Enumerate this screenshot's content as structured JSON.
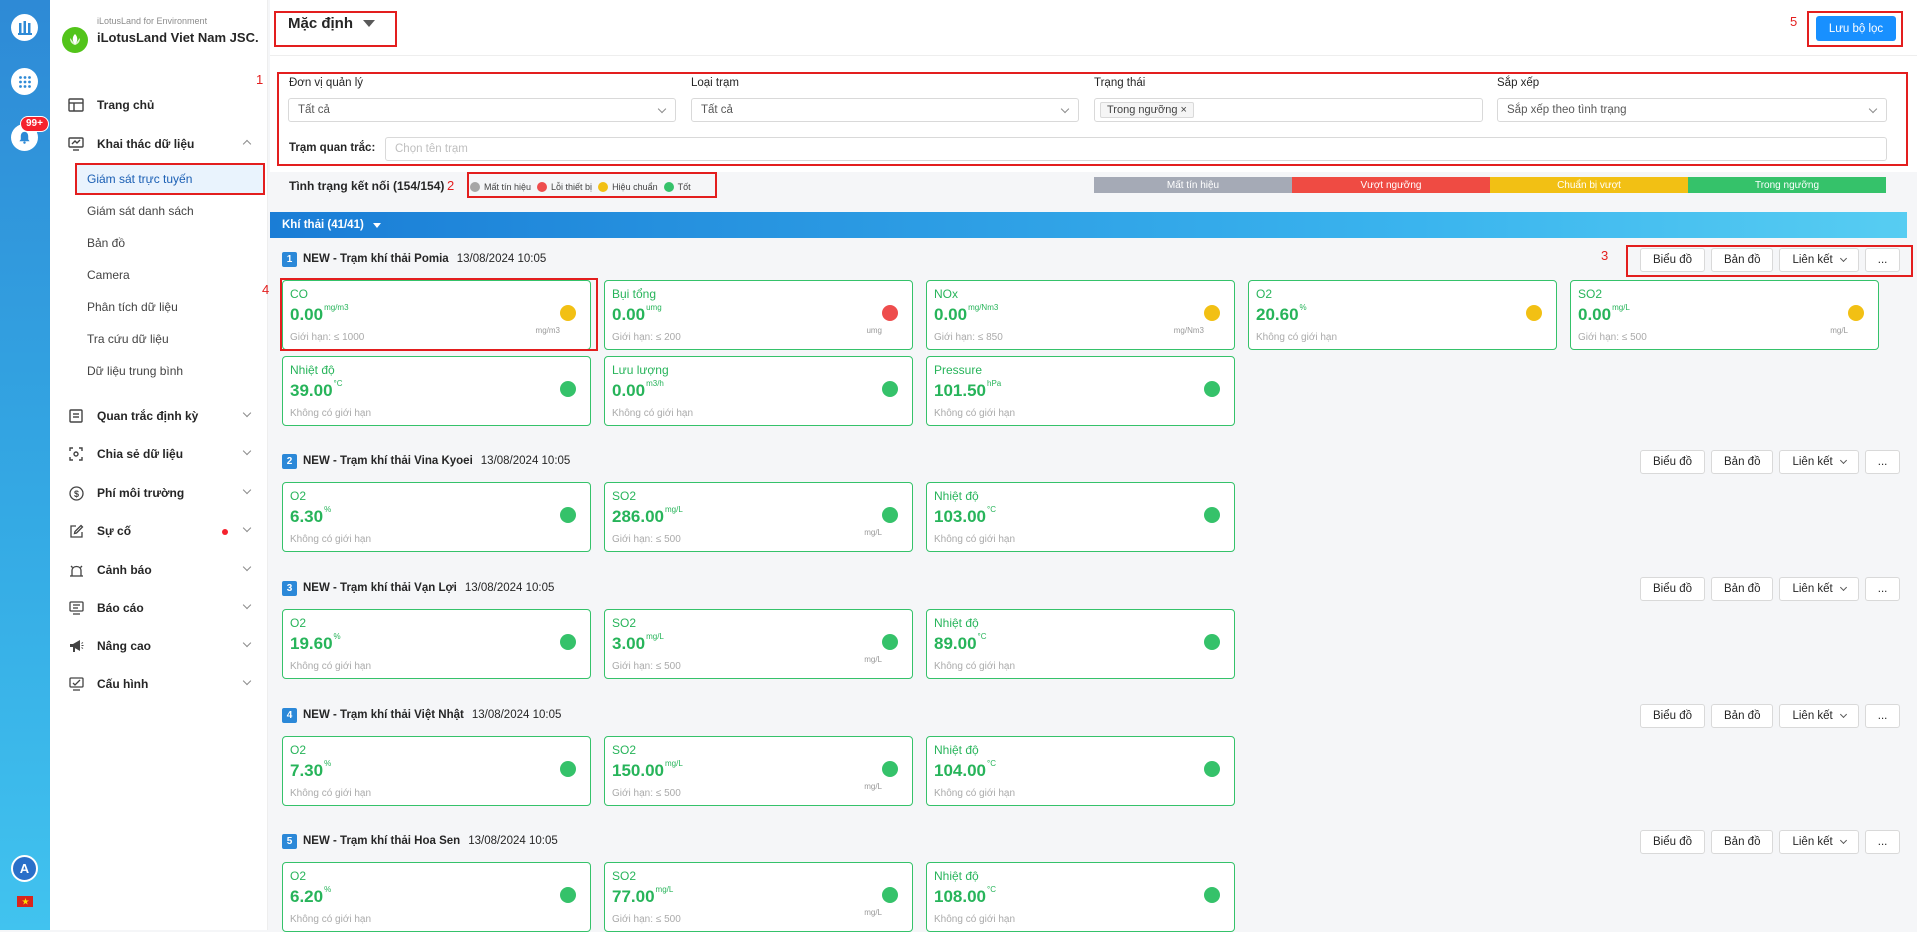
{
  "rail": {
    "badge": "99+",
    "avatar": "A"
  },
  "brand": {
    "sub": "iLotusLand for Environment",
    "name": "iLotusLand Viet Nam JSC."
  },
  "menu": {
    "home": "Trang chủ",
    "data_mining": "Khai thác dữ liệu",
    "sub": [
      "Giám sát trực tuyến",
      "Giám sát danh sách",
      "Bản đồ",
      "Camera",
      "Phân tích dữ liệu",
      "Tra cứu dữ liệu",
      "Dữ liệu trung bình"
    ],
    "periodic": "Quan trắc định kỳ",
    "share": "Chia sẻ dữ liệu",
    "fee": "Phí môi trường",
    "incident": "Sự cố",
    "alert": "Cảnh báo",
    "report": "Báo cáo",
    "advanced": "Nâng cao",
    "config": "Cấu hình"
  },
  "header": {
    "preset": "Mặc định",
    "save": "Lưu bộ lọc"
  },
  "annotations": [
    "1",
    "2",
    "3",
    "4",
    "5"
  ],
  "filters": {
    "unit_label": "Đơn vị quản lý",
    "unit_value": "Tất cả",
    "type_label": "Loại trạm",
    "type_value": "Tất cả",
    "status_label": "Trạng thái",
    "status_tag": "Trong ngưỡng",
    "sort_label": "Sắp xếp",
    "sort_value": "Sắp xếp theo tình trạng",
    "station_label": "Trạm quan trắc:",
    "station_placeholder": "Chọn tên trạm"
  },
  "connection": {
    "label": "Tình trạng kết nối (154/154)",
    "legend": [
      {
        "label": "Mất tín hiệu",
        "color": "#a6a6a6"
      },
      {
        "label": "Lỗi thiết bị",
        "color": "#ee4d4d"
      },
      {
        "label": "Hiệu chuẩn",
        "color": "#f2c014"
      },
      {
        "label": "Tốt",
        "color": "#35c26a"
      }
    ],
    "bar": [
      {
        "label": "Mất tín hiệu",
        "color": "#a5aab6"
      },
      {
        "label": "Vượt ngưỡng",
        "color": "#ef4b43"
      },
      {
        "label": "Chuẩn bị vượt",
        "color": "#f2c014"
      },
      {
        "label": "Trong ngưỡng",
        "color": "#35c26a"
      }
    ]
  },
  "group": {
    "label": "Khí thải (41/41)"
  },
  "actions": {
    "chart": "Biểu đồ",
    "map": "Bản đồ",
    "link": "Liên kết",
    "more": "..."
  },
  "stations": [
    {
      "num": "1",
      "name": "NEW - Trạm khí thải Pomia",
      "time": "13/08/2024 10:05",
      "cards": [
        {
          "name": "CO",
          "value": "0.00",
          "unit": "mg/m3",
          "limit": "Giới hạn: ≤ 1000",
          "unit2": "mg/m3",
          "dot": "#f2c014"
        },
        {
          "name": "Bụi tổng",
          "value": "0.00",
          "unit": "umg",
          "limit": "Giới hạn: ≤ 200",
          "unit2": "umg",
          "dot": "#ee4d4d"
        },
        {
          "name": "NOx",
          "value": "0.00",
          "unit": "mg/Nm3",
          "limit": "Giới hạn: ≤ 850",
          "unit2": "mg/Nm3",
          "dot": "#f2c014"
        },
        {
          "name": "O2",
          "value": "20.60",
          "unit": "%",
          "limit": "Không có giới hạn",
          "unit2": "",
          "dot": "#f2c014"
        },
        {
          "name": "SO2",
          "value": "0.00",
          "unit": "mg/L",
          "limit": "Giới hạn: ≤ 500",
          "unit2": "mg/L",
          "dot": "#f2c014"
        },
        {
          "name": "Nhiệt độ",
          "value": "39.00",
          "unit": "°C",
          "limit": "Không có giới hạn",
          "unit2": "",
          "dot": "#35c26a"
        },
        {
          "name": "Lưu lượng",
          "value": "0.00",
          "unit": "m3/h",
          "limit": "Không có giới hạn",
          "unit2": "",
          "dot": "#35c26a"
        },
        {
          "name": "Pressure",
          "value": "101.50",
          "unit": "hPa",
          "limit": "Không có giới hạn",
          "unit2": "",
          "dot": "#35c26a"
        }
      ]
    },
    {
      "num": "2",
      "name": "NEW - Trạm khí thải Vina Kyoei",
      "time": "13/08/2024 10:05",
      "cards": [
        {
          "name": "O2",
          "value": "6.30",
          "unit": "%",
          "limit": "Không có giới hạn",
          "unit2": "",
          "dot": "#35c26a"
        },
        {
          "name": "SO2",
          "value": "286.00",
          "unit": "mg/L",
          "limit": "Giới hạn: ≤ 500",
          "unit2": "mg/L",
          "dot": "#35c26a"
        },
        {
          "name": "Nhiệt độ",
          "value": "103.00",
          "unit": "°C",
          "limit": "Không có giới hạn",
          "unit2": "",
          "dot": "#35c26a"
        }
      ]
    },
    {
      "num": "3",
      "name": "NEW - Trạm khí thải Vạn Lợi",
      "time": "13/08/2024 10:05",
      "cards": [
        {
          "name": "O2",
          "value": "19.60",
          "unit": "%",
          "limit": "Không có giới hạn",
          "unit2": "",
          "dot": "#35c26a"
        },
        {
          "name": "SO2",
          "value": "3.00",
          "unit": "mg/L",
          "limit": "Giới hạn: ≤ 500",
          "unit2": "mg/L",
          "dot": "#35c26a"
        },
        {
          "name": "Nhiệt độ",
          "value": "89.00",
          "unit": "°C",
          "limit": "Không có giới hạn",
          "unit2": "",
          "dot": "#35c26a"
        }
      ]
    },
    {
      "num": "4",
      "name": "NEW - Trạm khí thải Việt Nhật",
      "time": "13/08/2024 10:05",
      "cards": [
        {
          "name": "O2",
          "value": "7.30",
          "unit": "%",
          "limit": "Không có giới hạn",
          "unit2": "",
          "dot": "#35c26a"
        },
        {
          "name": "SO2",
          "value": "150.00",
          "unit": "mg/L",
          "limit": "Giới hạn: ≤ 500",
          "unit2": "mg/L",
          "dot": "#35c26a"
        },
        {
          "name": "Nhiệt độ",
          "value": "104.00",
          "unit": "°C",
          "limit": "Không có giới hạn",
          "unit2": "",
          "dot": "#35c26a"
        }
      ]
    },
    {
      "num": "5",
      "name": "NEW - Trạm khí thải Hoa Sen",
      "time": "13/08/2024 10:05",
      "cards": [
        {
          "name": "O2",
          "value": "6.20",
          "unit": "%",
          "limit": "Không có giới hạn",
          "unit2": "",
          "dot": "#35c26a"
        },
        {
          "name": "SO2",
          "value": "77.00",
          "unit": "mg/L",
          "limit": "Giới hạn: ≤ 500",
          "unit2": "mg/L",
          "dot": "#35c26a"
        },
        {
          "name": "Nhiệt độ",
          "value": "108.00",
          "unit": "°C",
          "limit": "Không có giới hạn",
          "unit2": "",
          "dot": "#35c26a"
        }
      ]
    }
  ]
}
